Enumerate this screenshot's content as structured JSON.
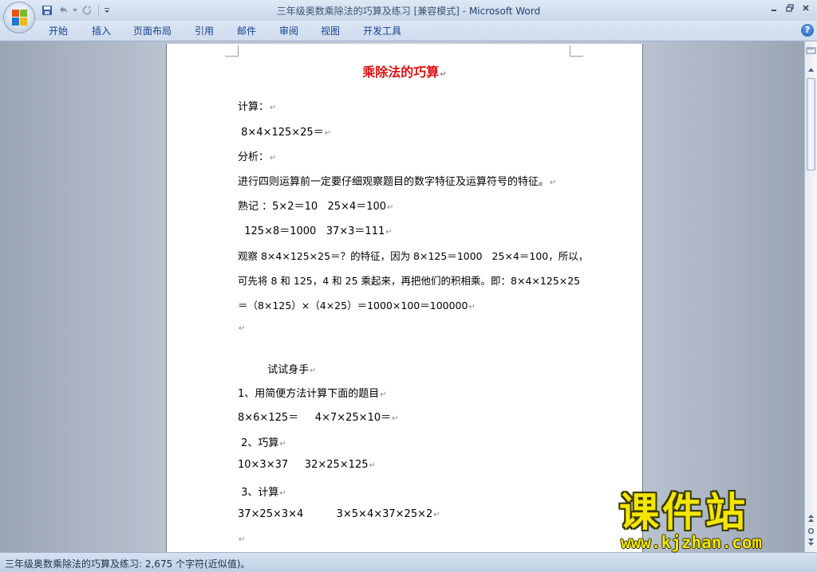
{
  "window": {
    "doc_name": "三年级奥数乘除法的巧算及练习 [兼容模式]",
    "separator": " - ",
    "app_name": "Microsoft Word"
  },
  "ribbon": {
    "tabs": [
      "开始",
      "插入",
      "页面布局",
      "引用",
      "邮件",
      "审阅",
      "视图",
      "开发工具"
    ]
  },
  "document": {
    "title": "乘除法的巧算",
    "lines": [
      "计算：",
      " 8×4×125×25＝",
      "分析：",
      "进行四则运算前一定要仔细观察题目的数字特征及运算符号的特征。",
      "熟记 ：5×2＝10   25×4＝100",
      "  125×8＝1000   37×3＝111",
      "观察 8×4×125×25＝？的特征，因为 8×125＝1000   25×4＝100，所以，",
      "可先将 8 和 125，4 和 25 乘起来，再把他们的积相乘。即：8×4×125×25",
      "＝（8×125）×（4×25）＝1000×100＝100000",
      "",
      "",
      "         试试身手",
      "1、用简便方法计算下面的题目",
      "8×6×125＝     4×7×25×10＝",
      " 2、巧算",
      "10×3×37     32×25×125",
      " 3、计算",
      "37×25×3×4          3×5×4×37×25×2",
      ""
    ]
  },
  "statusbar": {
    "text": "三年级奥数乘除法的巧算及练习: 2,675 个字符(近似值)。"
  },
  "watermark": {
    "cn": "课件站",
    "url": "www.kjzhan.com"
  },
  "colors": {
    "title_red": "#e01010",
    "ribbon_text": "#15428b",
    "watermark_yellow": "#f4e600"
  }
}
